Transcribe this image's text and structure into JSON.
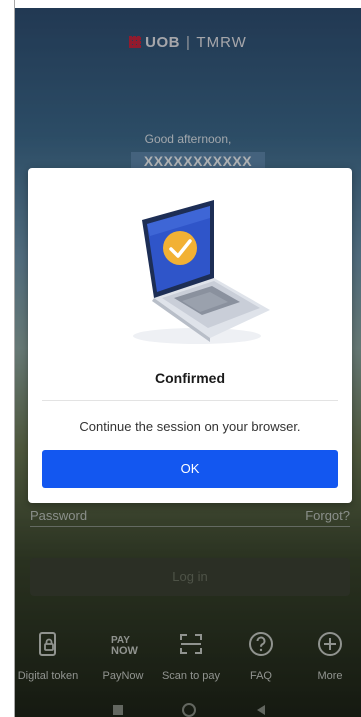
{
  "brand": {
    "bank": "UOB",
    "product": "TMRW"
  },
  "greeting": "Good afternoon,",
  "username": "XXXXXXXXXXX",
  "password": {
    "label": "Password",
    "forgot": "Forgot?"
  },
  "login": {
    "label": "Log in"
  },
  "quick_actions": [
    {
      "label": "Digital token",
      "icon": "digital-token-icon"
    },
    {
      "label": "PayNow",
      "icon": "paynow-icon",
      "icon_text_top": "PAY",
      "icon_text_bottom": "NOW"
    },
    {
      "label": "Scan to pay",
      "icon": "scan-icon"
    },
    {
      "label": "FAQ",
      "icon": "faq-icon"
    },
    {
      "label": "More",
      "icon": "plus-icon"
    }
  ],
  "dialog": {
    "title": "Confirmed",
    "message": "Continue the session on your browser.",
    "ok_label": "OK"
  },
  "colors": {
    "primary": "#1357f0",
    "brand_red": "#d9213b",
    "check_badge": "#f2b134"
  }
}
